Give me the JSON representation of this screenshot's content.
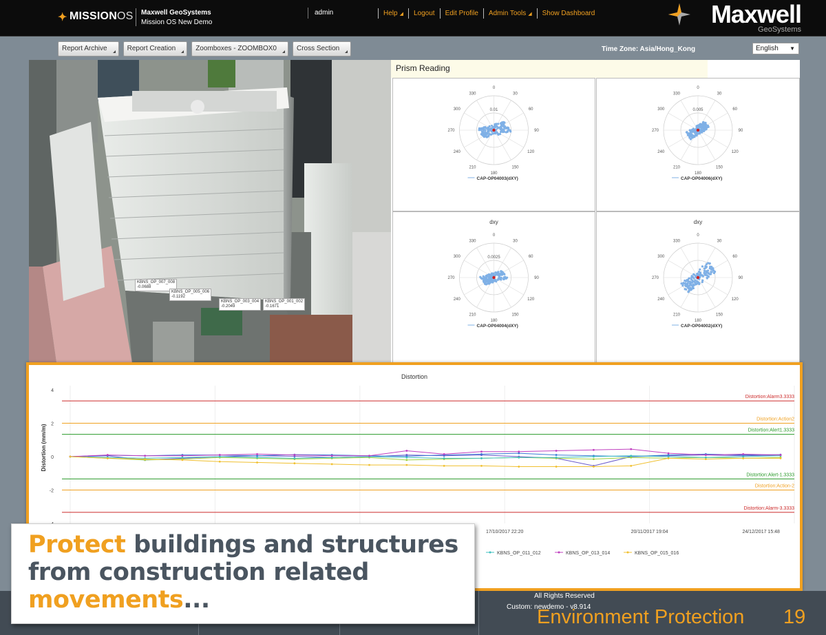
{
  "header": {
    "app_logo": "MISSION",
    "app_logo_suffix": "OS",
    "company": "Maxwell GeoSystems",
    "project": "Mission OS New Demo",
    "user": "admin",
    "nav": [
      {
        "label": "Help",
        "dropdown": true
      },
      {
        "label": "Logout",
        "dropdown": false
      },
      {
        "label": "Edit Profile",
        "dropdown": false
      },
      {
        "label": "Admin Tools",
        "dropdown": true
      },
      {
        "label": "Show Dashboard",
        "dropdown": false
      }
    ],
    "brand_name": "Maxwell",
    "brand_sub": "GeoSystems",
    "accent_color": "#f0a020"
  },
  "toolbar": {
    "buttons": [
      "Report Archive",
      "Report Creation",
      "Zoomboxes - ZOOMBOX0",
      "Cross Section"
    ],
    "timezone": "Time Zone: Asia/Hong_Kong",
    "language": "English"
  },
  "photo_labels": [
    {
      "name": "KBNS_OP_007_008",
      "value": "-0.0688"
    },
    {
      "name": "KBNS_OP_005_006",
      "value": "-0.1192"
    },
    {
      "name": "KBNS_OP_003_004",
      "value": "-0.2049"
    },
    {
      "name": "KBNS_OP_001_002",
      "value": "-0.1671"
    }
  ],
  "prism_panel": {
    "title": "Prism Reading",
    "plots": [
      {
        "title": "",
        "legend": "CAP-OP04003(dXY)",
        "ring_label": "0.01",
        "spread": 1.0,
        "tilt": -0.25
      },
      {
        "title": "",
        "legend": "CAP-OP04006(dXY)",
        "ring_label": "0.005",
        "spread": 0.7,
        "tilt": -0.6
      },
      {
        "title": "dxy",
        "legend": "CAP-OP04004(dXY)",
        "ring_label": "0.0025",
        "spread": 0.8,
        "tilt": -0.3
      },
      {
        "title": "dxy",
        "legend": "CAP-OP04002(dXY)",
        "ring_label": "",
        "spread": 1.05,
        "tilt": -0.75
      }
    ],
    "angles": [
      "0",
      "30",
      "60",
      "90",
      "120",
      "150",
      "180",
      "210",
      "240",
      "270",
      "300",
      "330"
    ]
  },
  "chart_data": {
    "type": "line",
    "title": "Distortion",
    "ylabel": "Distortion (mm/m)",
    "xlabel": "",
    "ylim": [
      -4,
      4
    ],
    "yticks": [
      "4",
      "2",
      "0",
      "-2",
      "-4"
    ],
    "xticks": [
      "17/10/2017 22:20",
      "20/11/2017 19:04",
      "24/12/2017 15:48"
    ],
    "thresholds": [
      {
        "label": "Distortion:Alarm3.3333",
        "value": 3.3333,
        "color": "#cc2a2a"
      },
      {
        "label": "Distortion:Action2",
        "value": 2,
        "color": "#f0a020"
      },
      {
        "label": "Distortion:Alert1.3333",
        "value": 1.3333,
        "color": "#2a9a2a"
      },
      {
        "label": "Distortion:Alert-1.3333",
        "value": -1.3333,
        "color": "#2a9a2a"
      },
      {
        "label": "Distortion:Action-2",
        "value": -2,
        "color": "#f0a020"
      },
      {
        "label": "Distortion:Alarm-3.3333",
        "value": -3.3333,
        "color": "#cc2a2a"
      }
    ],
    "n_points": 20,
    "series": [
      {
        "name": "",
        "color": "#6a5acd",
        "values": [
          0,
          0.05,
          -0.2,
          -0.1,
          0,
          0.05,
          0.02,
          -0.05,
          0,
          0.1,
          0.05,
          0.1,
          0,
          -0.1,
          -0.55,
          0,
          0.05,
          0.1,
          0.05,
          0.1
        ]
      },
      {
        "name": "",
        "color": "#3a7bd5",
        "values": [
          0,
          0.08,
          0.05,
          0.1,
          0.1,
          0.05,
          0.12,
          0.1,
          0.05,
          0.02,
          0.1,
          0.15,
          0.2,
          0.1,
          0.05,
          0,
          0.1,
          0.15,
          0.1,
          0.12
        ]
      },
      {
        "name": "",
        "color": "#a0d040",
        "values": [
          0,
          -0.1,
          -0.2,
          -0.15,
          -0.05,
          -0.1,
          -0.15,
          -0.1,
          -0.05,
          -0.2,
          -0.15,
          -0.1,
          -0.05,
          -0.1,
          -0.15,
          -0.05,
          -0.1,
          -0.05,
          -0.1,
          -0.05
        ]
      },
      {
        "name": "KBNS_OP_011_012",
        "color": "#40c0c0",
        "values": [
          0,
          -0.05,
          -0.1,
          -0.05,
          0,
          -0.05,
          -0.1,
          -0.05,
          0,
          -0.05,
          -0.1,
          -0.1,
          -0.05,
          -0.05,
          0,
          0.05,
          0,
          -0.05,
          0,
          0.05
        ]
      },
      {
        "name": "KBNS_OP_013_014",
        "color": "#c040c0",
        "values": [
          0,
          0.1,
          0.05,
          0.05,
          0.1,
          0.15,
          0.1,
          0.05,
          0.05,
          0.35,
          0.15,
          0.3,
          0.3,
          0.35,
          0.4,
          0.45,
          0.2,
          0.1,
          0.15,
          0.1
        ]
      },
      {
        "name": "KBNS_OP_015_016",
        "color": "#f0c030",
        "values": [
          0,
          -0.1,
          -0.15,
          -0.2,
          -0.3,
          -0.35,
          -0.4,
          -0.45,
          -0.5,
          -0.5,
          -0.55,
          -0.55,
          -0.6,
          -0.6,
          -0.6,
          -0.55,
          -0.1,
          -0.15,
          -0.1,
          -0.1
        ]
      }
    ]
  },
  "callout": {
    "w1": "Protect",
    "w2": " buildings and structures",
    "line2": "from construction related",
    "w3": "movements",
    "w4": "..."
  },
  "footer": {
    "rights": "All Rights Reserved",
    "custom": "Custom: newdemo - v8.914",
    "section": "Environment Protection",
    "page": "19"
  }
}
